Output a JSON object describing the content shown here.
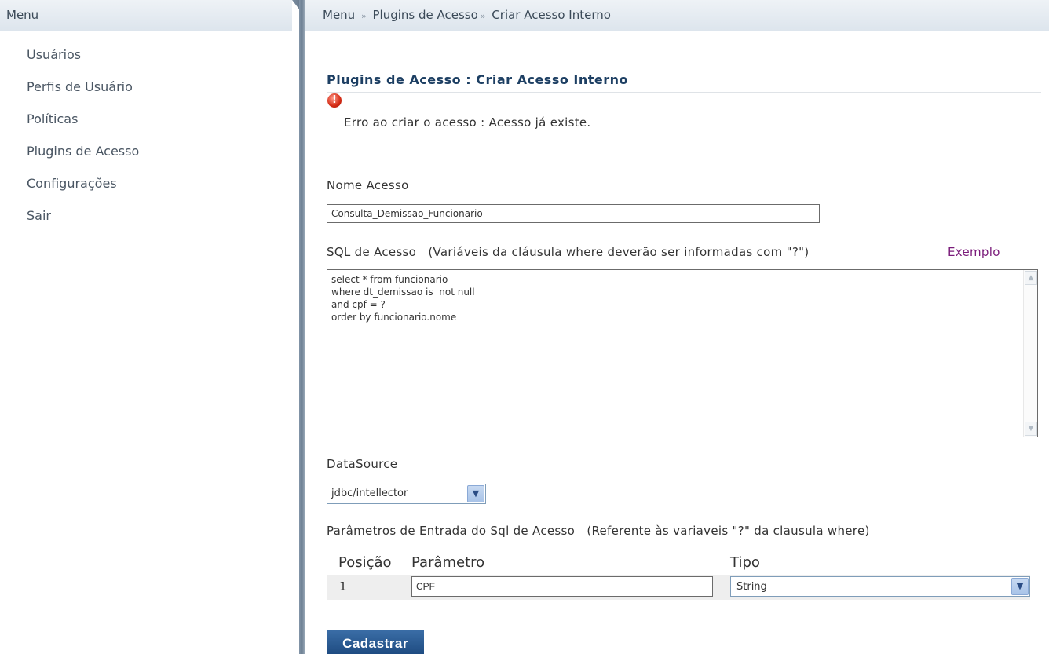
{
  "sidebar": {
    "title": "Menu",
    "items": [
      {
        "label": "Usuários"
      },
      {
        "label": "Perfis de Usuário"
      },
      {
        "label": "Políticas"
      },
      {
        "label": "Plugins de Acesso"
      },
      {
        "label": "Configurações"
      },
      {
        "label": "Sair"
      }
    ]
  },
  "breadcrumb": {
    "root": "Menu",
    "sep1": "»",
    "section": "Plugins de Acesso",
    "sep2": "»",
    "page": "Criar Acesso Interno"
  },
  "page": {
    "title": "Plugins de Acesso : Criar Acesso Interno",
    "error_icon": "!",
    "error": "Erro ao criar o acesso : Acesso já existe."
  },
  "form": {
    "nome_label": "Nome Acesso",
    "nome_value": "Consulta_Demissao_Funcionario",
    "sql_label": "SQL de Acesso   (Variáveis da cláusula where deverão ser informadas com \"?\")",
    "sql_example": "Exemplo",
    "sql_value": "select * from funcionario\nwhere dt_demissao is  not null\nand cpf = ?\norder by funcionario.nome",
    "datasource_label": "DataSource",
    "datasource_value": "jdbc/intellector",
    "params_label": "Parâmetros de Entrada do Sql de Acesso   (Referente às variaveis \"?\" da clausula where)",
    "params_headers": {
      "posicao": "Posição",
      "parametro": "Parâmetro",
      "tipo": "Tipo"
    },
    "params_rows": [
      {
        "posicao": "1",
        "parametro": "CPF",
        "tipo": "String"
      }
    ],
    "submit_label": "Cadastrar"
  },
  "icons": {
    "error": "error-icon",
    "dropdown": "chevron-down-icon",
    "scroll_up": "scroll-up-icon",
    "scroll_down": "scroll-down-icon"
  },
  "colors": {
    "title": "#1d3f63",
    "link_example": "#7a1b7a",
    "error": "#d42a14",
    "button": "#1f4c82"
  }
}
